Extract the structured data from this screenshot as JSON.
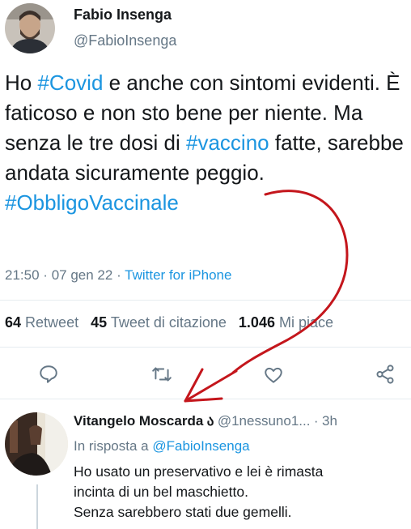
{
  "tweet": {
    "author_name": "Fabio Insenga",
    "author_handle": "@FabioInsenga",
    "text_parts": [
      {
        "text": "Ho ",
        "type": "text"
      },
      {
        "text": "#Covid",
        "type": "hashtag"
      },
      {
        "text": " e anche con sintomi evidenti. È faticoso e non sto bene per niente. Ma senza le tre dosi di ",
        "type": "text"
      },
      {
        "text": "#vaccino",
        "type": "hashtag"
      },
      {
        "text": " fatte, sarebbe andata sicuramente peggio. ",
        "type": "text"
      },
      {
        "text": "#ObbligoVaccinale",
        "type": "hashtag"
      }
    ],
    "time": "21:50",
    "date": "07 gen 22",
    "separator": "·",
    "source": "Twitter for iPhone",
    "stats": {
      "retweets_count": "64",
      "retweets_label": "Retweet",
      "quotes_count": "45",
      "quotes_label": "Tweet di citazione",
      "likes_count": "1.046",
      "likes_label": "Mi piace"
    }
  },
  "actions": [
    "reply-icon",
    "retweet-icon",
    "like-icon",
    "share-icon"
  ],
  "reply": {
    "author_name": "Vitangelo Moscarda",
    "author_badge": "ა",
    "author_handle": "@1nessuno1...",
    "separator": "·",
    "time": "3h",
    "in_reply_prefix": "In risposta a",
    "in_reply_handle": "@FabioInsenga",
    "lines": [
      "Ho usato un preservativo e lei è rimasta",
      "incinta di un bel maschietto.",
      "Senza sarebbero stati due gemelli."
    ]
  },
  "colors": {
    "link": "#1b95e0",
    "secondary_text": "#657786",
    "annotation_arrow": "#c4161c"
  }
}
